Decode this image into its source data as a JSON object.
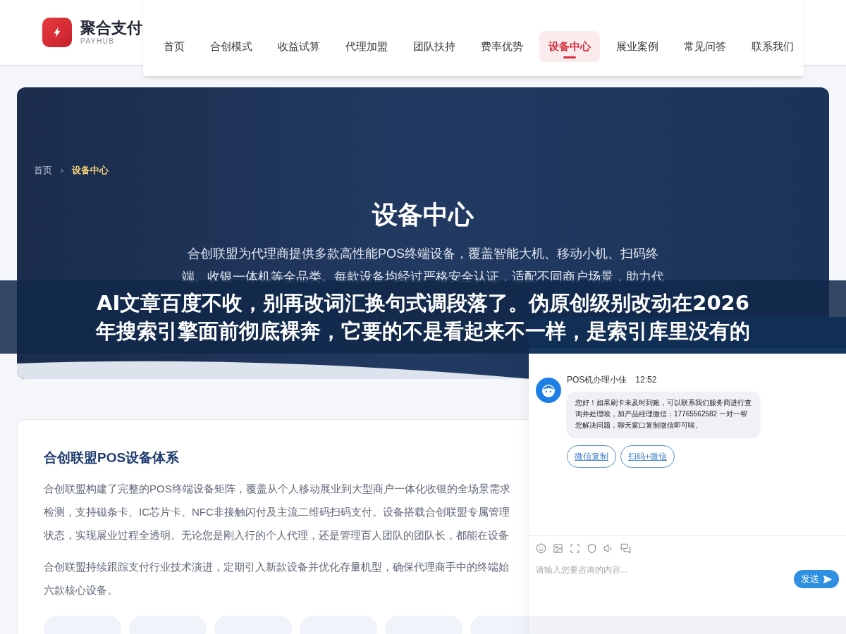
{
  "brand": {
    "name": "聚合支付",
    "sub": "PAYHUB"
  },
  "nav": [
    {
      "label": "首页",
      "selected": false
    },
    {
      "label": "合创模式",
      "selected": false
    },
    {
      "label": "收益试算",
      "selected": false
    },
    {
      "label": "代理加盟",
      "selected": false
    },
    {
      "label": "团队扶持",
      "selected": false
    },
    {
      "label": "费率优势",
      "selected": false
    },
    {
      "label": "设备中心",
      "selected": true
    },
    {
      "label": "展业案例",
      "selected": false
    },
    {
      "label": "常见问答",
      "selected": false
    },
    {
      "label": "联系我们",
      "selected": false
    }
  ],
  "breadcrumb": [
    {
      "label": "首页",
      "selected": false
    },
    {
      "label": "设备中心",
      "selected": true
    }
  ],
  "breadcrumb_sep": "›",
  "hero": {
    "title": "设备中心",
    "lines": [
      "合创联盟为代理商提供多款高性能POS终端设备，覆盖智能大机、移动小机、扫码终",
      "端、收银一体机等全品类。每款设备均经过严格安全认证，适配不同商户场景，助力代"
    ]
  },
  "banner": {
    "lines": [
      "AI文章百度不收，别再改词汇换句式调段落了。伪原创级别改动在2026",
      "年搜索引擎面前彻底裸奔，它要的不是看起来不一样，是索引库里没有的"
    ]
  },
  "section": {
    "title": "合创联盟POS设备体系",
    "paragraphs": [
      [
        "合创联盟构建了完整的POS终端设备矩阵，覆盖从个人移动展业到大型商户一体化收银的全场景需求",
        "检测，支持磁条卡、IC芯片卡、NFC非接触闪付及主流二维码扫码支付。设备搭载合创联盟专属管理",
        "状态，实现展业过程全透明。无论您是刚入行的个人代理，还是管理百人团队的团队长，都能在设备"
      ],
      [
        "合创联盟持续跟踪支付行业技术演进，定期引入新款设备并优化存量机型，确保代理商手中的终端始",
        "六款核心设备。"
      ]
    ]
  },
  "chat": {
    "agent": "POS机办理小佳",
    "time": "12:52",
    "message": "您好！如果刷卡未及时到账，可以联系我们服务商进行查询并处理唉，加产品经理微信：17765562582 一对一帮您解决问题，聊天窗口复制微信即可唉。",
    "actions": [
      "微信复制",
      "扫码+微信"
    ],
    "input": {
      "placeholder": "请输入您要咨询的内容..."
    },
    "send": "发送"
  }
}
